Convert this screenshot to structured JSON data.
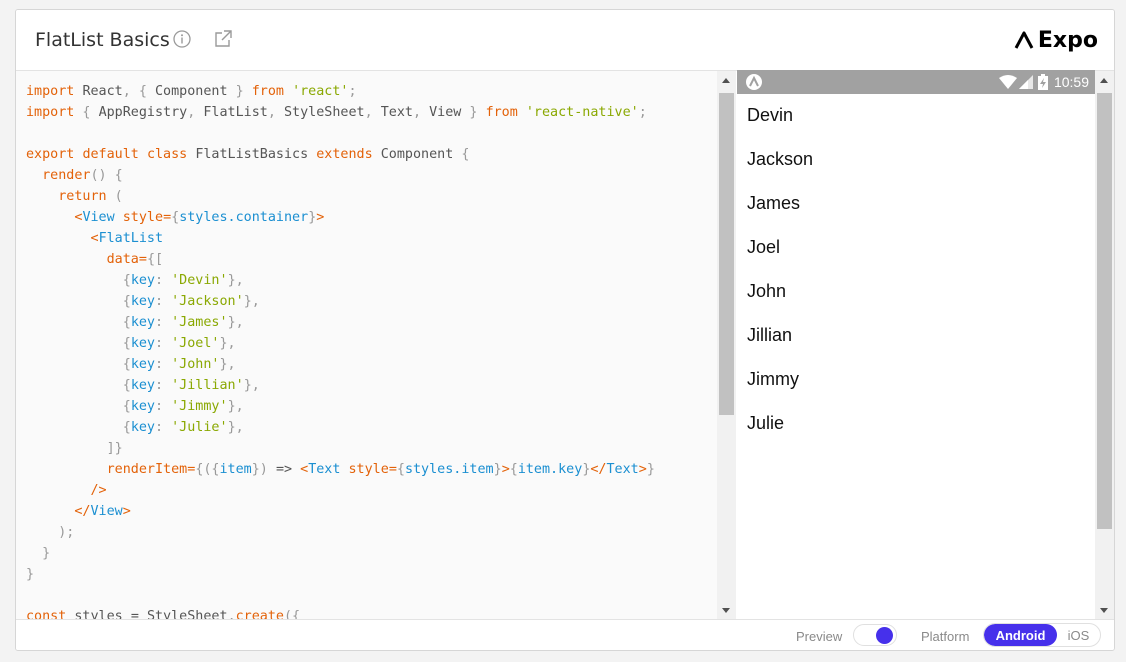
{
  "header": {
    "title": "FlatList Basics",
    "brand": "Expo",
    "info_icon": "info-icon",
    "external_icon": "open-external-icon"
  },
  "editor": {
    "tokens": {
      "import": "import",
      "react_name": "React",
      "component": "Component",
      "from": "from",
      "react_str": "'react'",
      "appregistry": "AppRegistry",
      "flatlist": "FlatList",
      "stylesheet": "StyleSheet",
      "text": "Text",
      "view": "View",
      "rn_str": "'react-native'",
      "export": "export",
      "default": "default",
      "class": "class",
      "class_name": "FlatListBasics",
      "extends": "extends",
      "render": "render",
      "return": "return",
      "style_attr": "style",
      "styles_container": "styles.container",
      "data_attr": "data",
      "key": "key",
      "render_item": "renderItem",
      "item": "item",
      "styles_item": "styles.item",
      "item_key": "item.key",
      "const": "const",
      "styles_var": "styles",
      "create": "create"
    },
    "names": [
      "'Devin'",
      "'Jackson'",
      "'James'",
      "'Joel'",
      "'John'",
      "'Jillian'",
      "'Jimmy'",
      "'Julie'"
    ]
  },
  "phone": {
    "status_time": "10:59",
    "items": [
      "Devin",
      "Jackson",
      "James",
      "Joel",
      "John",
      "Jillian",
      "Jimmy",
      "Julie"
    ]
  },
  "footer": {
    "preview_label": "Preview",
    "preview_on": true,
    "platform_label": "Platform",
    "platforms": [
      "Android",
      "iOS"
    ],
    "selected_platform": "Android",
    "accent": "#4630eb"
  }
}
